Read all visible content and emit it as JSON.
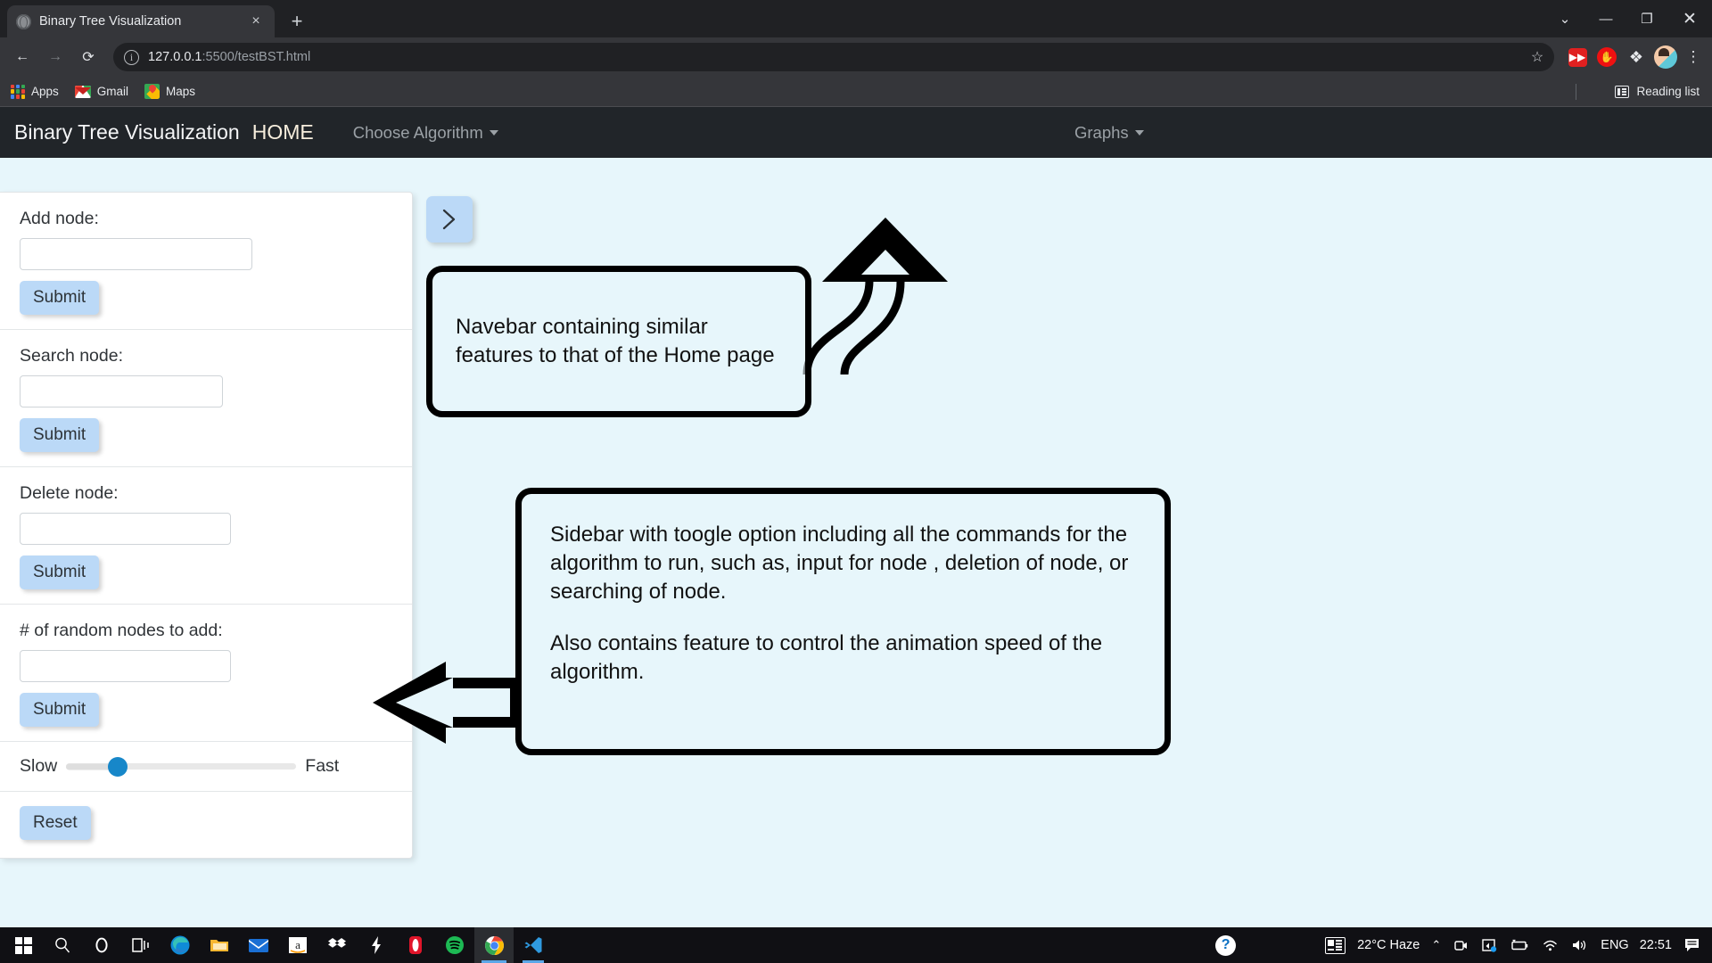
{
  "browser": {
    "tab": {
      "title": "Binary Tree Visualization",
      "favicon": "globe-icon",
      "close": "×"
    },
    "new_tab_label": "+",
    "window_controls": {
      "minimize_all": "⌄",
      "minimize": "—",
      "maximize": "❐",
      "close": "✕"
    },
    "nav": {
      "back": "←",
      "forward": "→",
      "reload": "⟳"
    },
    "omnibox": {
      "host": "127.0.0.1",
      "path": ":5500/testBST.html",
      "info_glyph": "i",
      "star_glyph": "☆"
    },
    "extensions": [
      {
        "name": "fast-forward-extension-icon",
        "glyph": "»"
      },
      {
        "name": "stop-hand-extension-icon",
        "glyph": "✋"
      },
      {
        "name": "extensions-puzzle-icon",
        "glyph": "🧩"
      }
    ],
    "profile": "avatar",
    "menu_glyph": "⋮",
    "bookmarks": [
      {
        "label": "Apps",
        "icon": "apps-grid-icon"
      },
      {
        "label": "Gmail",
        "icon": "gmail-icon"
      },
      {
        "label": "Maps",
        "icon": "google-maps-icon"
      }
    ],
    "reading_list": {
      "label": "Reading list",
      "icon": "reading-list-icon"
    }
  },
  "page": {
    "navbar": {
      "brand": "Binary Tree Visualization",
      "home": "HOME",
      "choose_algorithm": "Choose Algorithm",
      "graphs": "Graphs",
      "bg_color": "#212529",
      "home_color": "#f7eedd",
      "link_color": "#9ba1a6"
    },
    "background_color": "#e7f6fb",
    "toggle_button": {
      "icon": "chevron-right-icon",
      "color": "#bbd9f7"
    },
    "sidebar": {
      "sections": [
        {
          "label": "Add node:",
          "button": "Submit",
          "value": "",
          "placeholder": ""
        },
        {
          "label": "Search node:",
          "button": "Submit",
          "value": "",
          "placeholder": ""
        },
        {
          "label": "Delete node:",
          "button": "Submit",
          "value": "",
          "placeholder": ""
        },
        {
          "label": "# of random nodes to add:",
          "button": "Submit",
          "value": "",
          "placeholder": ""
        }
      ],
      "speed": {
        "slow_label": "Slow",
        "fast_label": "Fast",
        "value": 20,
        "min": 0,
        "max": 100,
        "thumb_color": "#1787c9"
      },
      "reset_button": "Reset",
      "button_color": "#bbd9f7"
    },
    "annotations": [
      {
        "name": "navbar-annotation",
        "text": "Navebar containing similar features to that of the Home page"
      },
      {
        "name": "sidebar-annotation",
        "paragraph_1": "Sidebar with toogle option including all the commands for the algorithm to run, such as, input for node , deletion of node, or searching of node.",
        "paragraph_2": "Also contains feature to control the animation speed of the algorithm."
      }
    ]
  },
  "taskbar": {
    "items": [
      {
        "name": "start-button",
        "icon": "windows-logo-icon"
      },
      {
        "name": "search-button",
        "icon": "search-icon",
        "glyph": "⚲"
      },
      {
        "name": "cortana-button",
        "icon": "cortana-circle-icon",
        "glyph": "◯"
      },
      {
        "name": "task-view-button",
        "icon": "task-view-icon"
      },
      {
        "name": "edge-button",
        "icon": "microsoft-edge-icon"
      },
      {
        "name": "file-explorer-button",
        "icon": "file-explorer-icon"
      },
      {
        "name": "mail-button",
        "icon": "mail-envelope-icon"
      },
      {
        "name": "amazon-button",
        "icon": "amazon-icon",
        "glyph": "a"
      },
      {
        "name": "dropbox-button",
        "icon": "dropbox-icon"
      },
      {
        "name": "flash-button",
        "icon": "lightning-bolt-icon"
      },
      {
        "name": "opera-button",
        "icon": "opera-gx-icon"
      },
      {
        "name": "spotify-button",
        "icon": "spotify-icon"
      },
      {
        "name": "chrome-button",
        "icon": "google-chrome-icon"
      },
      {
        "name": "vscode-button",
        "icon": "visual-studio-code-icon"
      }
    ],
    "tray": {
      "help": "?",
      "weather": "22°C  Haze",
      "expand_glyph": "⌃",
      "camera_icon": "camera-icon",
      "onedrive_icon": "onedrive-icon",
      "battery_icon": "battery-icon",
      "wifi_icon": "wifi-icon",
      "volume_icon": "volume-icon",
      "language": "ENG",
      "time": "22:51",
      "action_center_icon": "action-center-icon"
    }
  }
}
